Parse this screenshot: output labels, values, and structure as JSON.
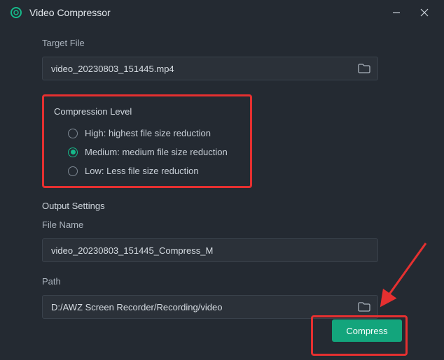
{
  "window": {
    "title": "Video Compressor"
  },
  "target_file": {
    "label": "Target File",
    "value": "video_20230803_151445.mp4"
  },
  "compression": {
    "label": "Compression Level",
    "options": {
      "high": "High: highest file size reduction",
      "medium": "Medium: medium file size reduction",
      "low": "Low: Less file size reduction"
    },
    "selected": "medium"
  },
  "output": {
    "section_label": "Output Settings",
    "filename_label": "File Name",
    "filename_value": "video_20230803_151445_Compress_M",
    "path_label": "Path",
    "path_value": "D:/AWZ Screen Recorder/Recording/video"
  },
  "buttons": {
    "compress": "Compress"
  },
  "colors": {
    "accent": "#13a57c",
    "highlight": "#e53030",
    "bg": "#242a32"
  }
}
